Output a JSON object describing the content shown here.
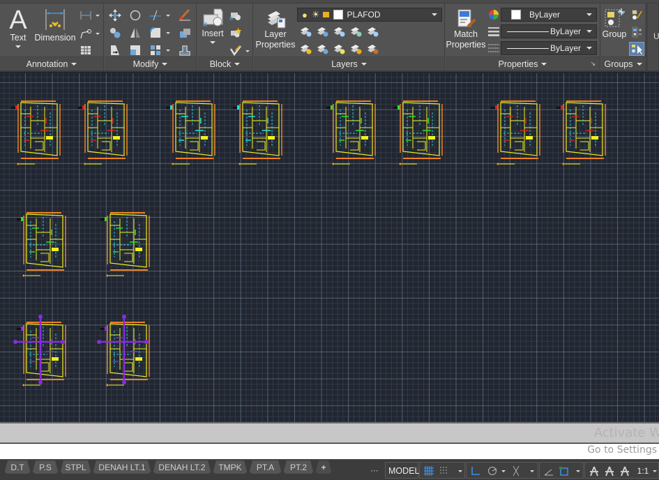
{
  "ribbon": {
    "panels": {
      "annotation": {
        "label": "Annotation",
        "buttons": {
          "text": "Text",
          "dimension": "Dimension"
        },
        "icons": [
          "linear-dimension-icon",
          "leader-icon",
          "table-icon"
        ]
      },
      "modify": {
        "label": "Modify",
        "icons": [
          "move-icon",
          "rotate-icon",
          "trim-icon",
          "erase-icon",
          "copy-icon",
          "mirror-icon",
          "fillet-icon",
          "explode-icon",
          "stretch-icon",
          "scale-icon",
          "array-icon",
          "offset-icon"
        ]
      },
      "block": {
        "label": "Block",
        "buttons": {
          "insert": "Insert"
        },
        "icons": [
          "create-block-icon",
          "edit-block-icon",
          "edit-attributes-icon"
        ]
      },
      "layers": {
        "label": "Layers",
        "buttons": {
          "layer_properties_line1": "Layer",
          "layer_properties_line2": "Properties"
        },
        "current_layer": "PLAFOD",
        "layer_state_icons": [
          "layer-on-icon",
          "layer-thaw-icon",
          "layer-unlock-icon"
        ],
        "tool_icons": [
          "layer-isolate-icon",
          "layer-match-icon",
          "layer-freeze-icon",
          "layer-lock-icon",
          "make-current-icon",
          "layer-unisolate-icon",
          "layer-walk-icon",
          "layer-thaw-all-icon",
          "layer-unlock-all-icon",
          "layer-merge-icon"
        ]
      },
      "properties": {
        "label": "Properties",
        "buttons": {
          "match_line1": "Match",
          "match_line2": "Properties"
        },
        "color": "ByLayer",
        "lineweight": "ByLayer",
        "linetype": "ByLayer"
      },
      "groups": {
        "label": "Groups",
        "buttons": {
          "group": "Group"
        }
      },
      "cutoff_label": "U"
    }
  },
  "canvas": {
    "background": "#212630",
    "drawings": [
      {
        "name": "plan-1",
        "row": 1,
        "accent": "#e02020"
      },
      {
        "name": "plan-2",
        "row": 1,
        "accent": "#e02020"
      },
      {
        "name": "plan-3",
        "row": 1,
        "accent": "#20e0e0"
      },
      {
        "name": "plan-4",
        "row": 1,
        "accent": "#20e0e0"
      },
      {
        "name": "plan-5",
        "row": 1,
        "accent": "#30e030"
      },
      {
        "name": "plan-6",
        "row": 1,
        "accent": "#30e030"
      },
      {
        "name": "plan-7",
        "row": 1,
        "accent": "#d02020"
      },
      {
        "name": "plan-8",
        "row": 1,
        "accent": "#d02020"
      },
      {
        "name": "plan-9",
        "row": 2,
        "accent": "#30e030"
      },
      {
        "name": "plan-10",
        "row": 2,
        "accent": "#30e030"
      },
      {
        "name": "plan-11",
        "row": 3,
        "accent": "#8a2be2",
        "selected": true
      },
      {
        "name": "plan-12",
        "row": 3,
        "accent": "#8a2be2",
        "selected": true
      }
    ]
  },
  "command_line": {
    "input_value": "",
    "watermark_title": "Activate W",
    "watermark_sub": "Go to Settings"
  },
  "layout_tabs": [
    "D.T",
    "P.S",
    "STPL",
    "DENAH LT.1",
    "DENAH LT.2",
    "TMPK",
    "PT.A",
    "PT.2"
  ],
  "add_tab_label": "+",
  "status_bar": {
    "model": "MODEL",
    "scale": "1:1",
    "icons": [
      "grid-icon",
      "snap-icon",
      "ortho-icon",
      "polar-icon",
      "isodraft-icon",
      "object-snap-tracking-icon",
      "osnap-icon",
      "annotation-visibility-icon",
      "autoscale-icon",
      "annotation-scale-icon"
    ]
  }
}
